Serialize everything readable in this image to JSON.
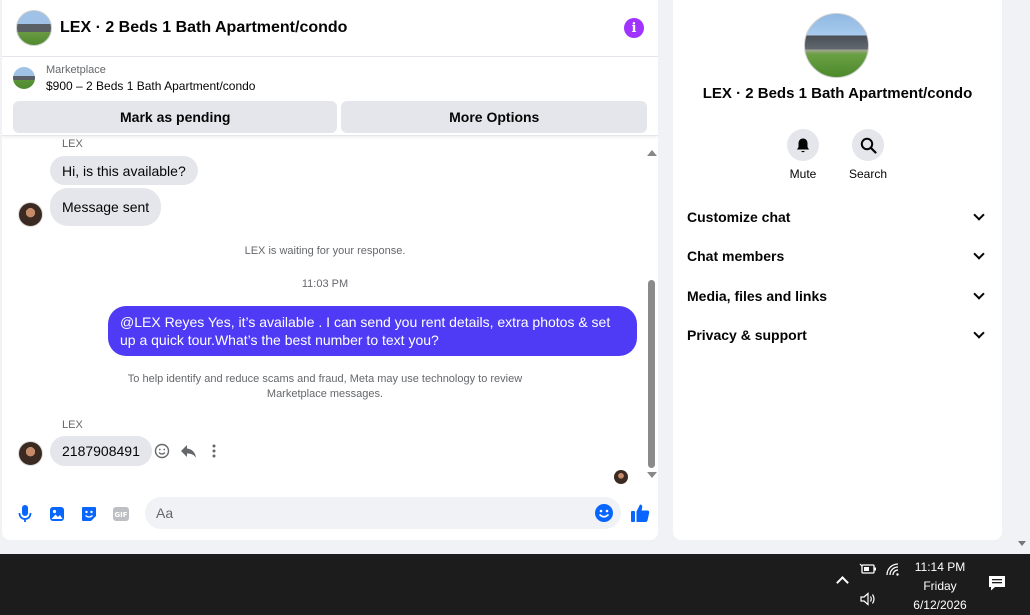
{
  "chat": {
    "title": "LEX · 2 Beds 1 Bath Apartment/condo",
    "listing": {
      "label": "Marketplace",
      "price_title": "$900 – 2 Beds 1 Bath Apartment/condo"
    },
    "actions": {
      "pending": "Mark as pending",
      "more": "More Options"
    },
    "messages": {
      "top_sender": "LEX",
      "msg1": "Hi, is this available?",
      "msg2": "Message sent",
      "waiting": "LEX is waiting for your response.",
      "timestamp": "11:03 PM",
      "outgoing": "@LEX Reyes Yes, it’s available .  I can send you rent details, extra photos & set up a quick tour.What’s the best number to text you?",
      "scam_notice_1": "To help identify and reduce scams and fraud, Meta may use technology to review",
      "scam_notice_2": "Marketplace messages.",
      "sender2": "LEX",
      "phone_reply": "2187908491"
    },
    "composer": {
      "placeholder": "Aa"
    }
  },
  "details": {
    "title": "LEX · 2 Beds 1 Bath Apartment/condo",
    "mute": "Mute",
    "search": "Search",
    "sections": [
      "Customize chat",
      "Chat members",
      "Media, files and links",
      "Privacy & support"
    ]
  },
  "taskbar": {
    "time": "11:14 PM",
    "day": "Friday",
    "date": "6/12/2026"
  },
  "colors": {
    "accent_blue": "#0866ff",
    "outgoing_bubble": "#4f3bf5",
    "info_purple": "#a033ff"
  }
}
